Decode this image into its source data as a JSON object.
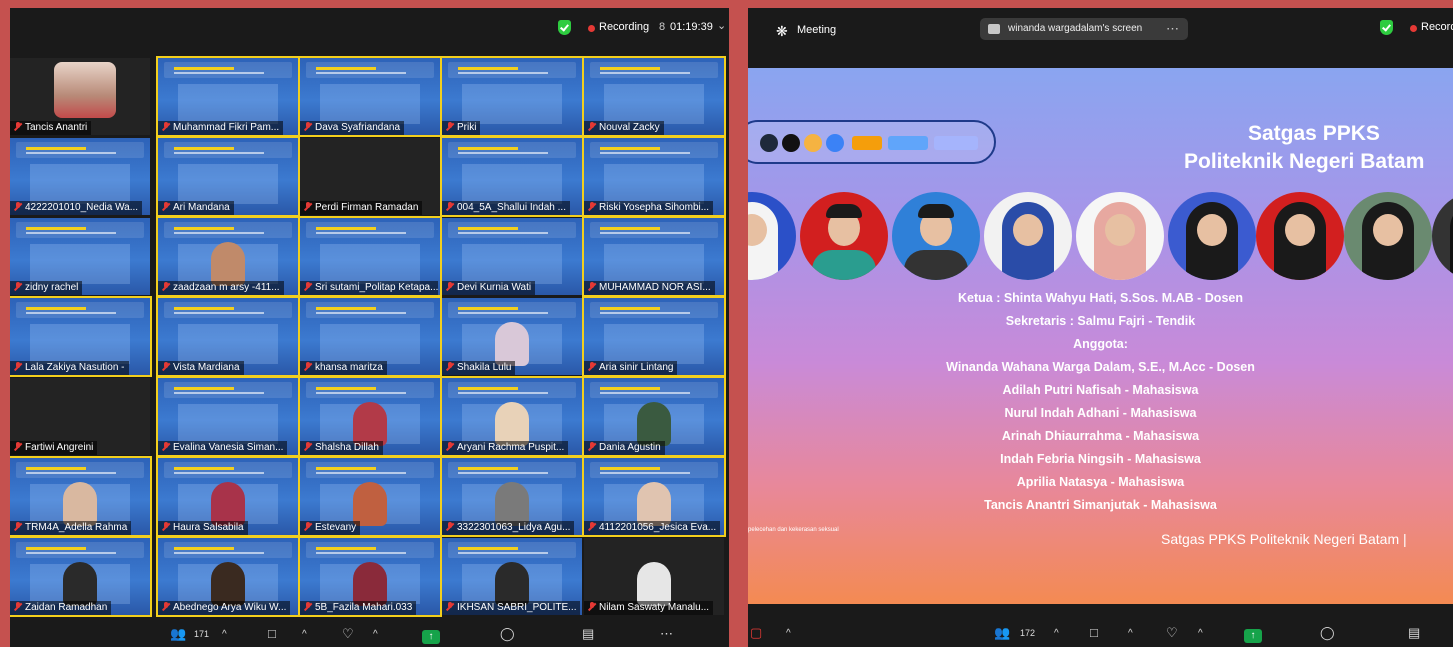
{
  "left": {
    "top_bar": {
      "recording_label": "Recording",
      "timer_icon": "8",
      "timer": "01:19:39",
      "chevron": "⌄"
    },
    "participants": [
      "Tancis Anantri",
      "Muhammad Fikri Pam...",
      "Dava Syafriandana",
      "Priki",
      "Nouval Zacky",
      "4222201010_Nedia Wa...",
      "Ari Mandana",
      "Perdi Firman Ramadan",
      "004_5A_Shallui Indah ...",
      "Riski Yosepha Sihombi...",
      "zidny rachel",
      "zaadzaan m arsy -411...",
      "Sri sutami_Politap Ketapa...",
      "Devi Kurnia Wati",
      "MUHAMMAD NOR ASI...",
      "Lala Zakiya Nasution -",
      "Vista Mardiana",
      "khansa maritza",
      "Shakila Lulu",
      "Aria sinir Lintang",
      "Fartiwi Angreini",
      "Evalina Vanesia Siman...",
      "Shalsha Dillah",
      "Aryani Rachma Puspit...",
      "Dania Agustin",
      "TRM4A_Adella Rahma",
      "Haura Salsabila",
      "Estevany",
      "3322301063_Lidya Agu...",
      "4112201056_Jesica Eva...",
      "Zaidan Ramadhan",
      "Abednego Arya Wiku W...",
      "5B_Fazila Mahari.033",
      "IKHSAN SABRI_POLITE...",
      "Nilam Saswaty Manalu..."
    ],
    "bottom_bar": {
      "participants_icon": "people-icon",
      "participants_count": "171",
      "caret": "^"
    }
  },
  "right": {
    "top_bar": {
      "meeting_label": "Meeting",
      "share_label": "winanda wargadalam's screen",
      "share_more": "⋯",
      "recording_label": "Record"
    },
    "slide": {
      "title": "Satgas PPKS",
      "subtitle": "Politeknik Negeri Batam",
      "lines": [
        "Ketua : Shinta Wahyu Hati, S.Sos. M.AB - Dosen",
        "Sekretaris : Salmu Fajri - Tendik",
        "Anggota:",
        "Winanda Wahana Warga Dalam, S.E., M.Acc - Dosen",
        "Adilah Putri Nafisah - Mahasiswa",
        "Nurul Indah Adhani - Mahasiswa",
        "Arinah Dhiaurrahma - Mahasiswa",
        "Indah Febria Ningsih - Mahasiswa",
        "Aprilia Natasya - Mahasiswa",
        "Tancis Anantri Simanjutak - Mahasiswa"
      ],
      "footer_small": "pelecehan dan kekerasan seksual",
      "footer": "Satgas PPKS Politeknik Negeri Batam |"
    },
    "bottom_bar": {
      "participants_count": "172",
      "caret": "^"
    }
  },
  "colors": {
    "background": "#c5514f",
    "active_speaker": "#f2cf1d",
    "recording": "#e53935",
    "secure": "#2ecc40",
    "share_button": "#16a34a"
  }
}
